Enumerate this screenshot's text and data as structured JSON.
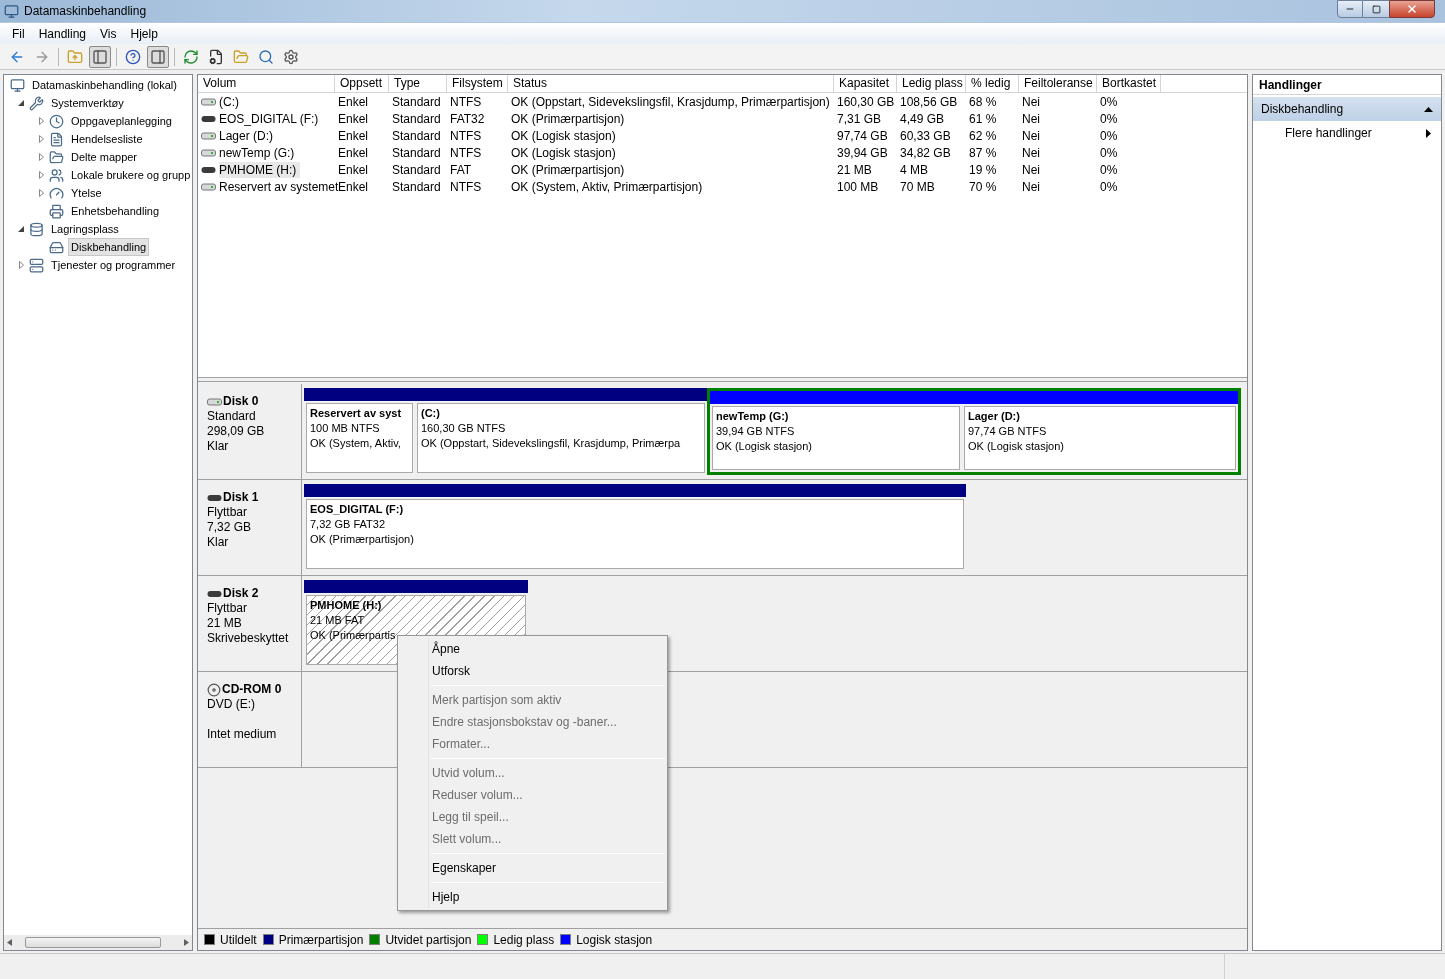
{
  "window": {
    "title": "Datamaskinbehandling"
  },
  "menu": [
    "Fil",
    "Handling",
    "Vis",
    "Hjelp"
  ],
  "toolbar": [
    {
      "pressed": false,
      "disabled": false
    },
    {
      "pressed": false,
      "disabled": true
    },
    {
      "pressed": false,
      "disabled": false
    },
    {
      "pressed": true,
      "disabled": false
    },
    {
      "pressed": false,
      "disabled": false
    },
    {
      "pressed": true,
      "disabled": false
    },
    {
      "pressed": false,
      "disabled": false
    },
    {
      "pressed": false,
      "disabled": false
    },
    {
      "pressed": false,
      "disabled": false
    },
    {
      "pressed": false,
      "disabled": false
    },
    {
      "pressed": false,
      "disabled": false
    }
  ],
  "tree": [
    {
      "label": "Datamaskinbehandling (lokal)",
      "selected": false,
      "children": [
        {
          "label": "Systemverktøy",
          "selected": false,
          "expanded": true,
          "children": [
            {
              "label": "Oppgaveplanlegging",
              "selected": false,
              "expanded": false
            },
            {
              "label": "Hendelsesliste",
              "selected": false,
              "expanded": false
            },
            {
              "label": "Delte mapper",
              "selected": false,
              "expanded": false
            },
            {
              "label": "Lokale brukere og grupp",
              "selected": false,
              "expanded": false
            },
            {
              "label": "Ytelse",
              "selected": false,
              "expanded": false
            },
            {
              "label": "Enhetsbehandling",
              "selected": false
            }
          ]
        },
        {
          "label": "Lagringsplass",
          "selected": false,
          "expanded": true,
          "children": [
            {
              "label": "Diskbehandling",
              "selected": true
            }
          ]
        },
        {
          "label": "Tjenester og programmer",
          "selected": false,
          "expanded": false
        }
      ]
    }
  ],
  "volumes": {
    "columns": [
      "Volum",
      "Oppsett",
      "Type",
      "Filsystem",
      "Status",
      "Kapasitet",
      "Ledig plass",
      "% ledig",
      "Feiltoleranse",
      "Bortkastet"
    ],
    "rows": [
      {
        "kind": "fixed",
        "selected": false,
        "cells": [
          "(C:)",
          "Enkel",
          "Standard",
          "NTFS",
          "OK (Oppstart, Sidevekslingsfil, Krasjdump, Primærpartisjon)",
          "160,30 GB",
          "108,56 GB",
          "68 %",
          "Nei",
          "0%"
        ]
      },
      {
        "kind": "removable",
        "selected": false,
        "cells": [
          "EOS_DIGITAL (F:)",
          "Enkel",
          "Standard",
          "FAT32",
          "OK (Primærpartisjon)",
          "7,31 GB",
          "4,49 GB",
          "61 %",
          "Nei",
          "0%"
        ]
      },
      {
        "kind": "fixed",
        "selected": false,
        "cells": [
          "Lager (D:)",
          "Enkel",
          "Standard",
          "NTFS",
          "OK (Logisk stasjon)",
          "97,74 GB",
          "60,33 GB",
          "62 %",
          "Nei",
          "0%"
        ]
      },
      {
        "kind": "fixed",
        "selected": false,
        "cells": [
          "newTemp (G:)",
          "Enkel",
          "Standard",
          "NTFS",
          "OK (Logisk stasjon)",
          "39,94 GB",
          "34,82 GB",
          "87 %",
          "Nei",
          "0%"
        ]
      },
      {
        "kind": "removable",
        "selected": true,
        "cells": [
          "PMHOME (H:)",
          "Enkel",
          "Standard",
          "FAT",
          "OK (Primærpartisjon)",
          "21 MB",
          "4 MB",
          "19 %",
          "Nei",
          "0%"
        ]
      },
      {
        "kind": "fixed",
        "selected": false,
        "cells": [
          "Reservert av systemet",
          "Enkel",
          "Standard",
          "NTFS",
          "OK (System, Aktiv, Primærpartisjon)",
          "100 MB",
          "70 MB",
          "70 %",
          "Nei",
          "0%"
        ]
      }
    ]
  },
  "disks": [
    {
      "kind": "fixed",
      "name": "Disk 0",
      "lines": [
        "Standard",
        "298,09 GB",
        "Klar"
      ],
      "partitions": [
        {
          "kind": "primary",
          "selected": false,
          "name": "Reservert av syst",
          "lines": [
            "100 MB NTFS",
            "OK (System, Aktiv,"
          ]
        },
        {
          "kind": "primary",
          "selected": false,
          "name": "(C:)",
          "lines": [
            "160,30 GB NTFS",
            "OK (Oppstart, Sidevekslingsfil, Krasjdump, Primærpa"
          ]
        },
        {
          "kind": "extended",
          "children": [
            {
              "kind": "logical",
              "selected": false,
              "name": "newTemp (G:)",
              "lines": [
                "39,94 GB NTFS",
                "OK (Logisk stasjon)"
              ]
            },
            {
              "kind": "logical",
              "selected": false,
              "name": "Lager (D:)",
              "lines": [
                "97,74 GB NTFS",
                "OK (Logisk stasjon)"
              ]
            }
          ]
        }
      ]
    },
    {
      "kind": "removable",
      "name": "Disk 1",
      "lines": [
        "Flyttbar",
        "7,32 GB",
        "Klar"
      ],
      "partitions": [
        {
          "kind": "primary",
          "selected": false,
          "name": "EOS_DIGITAL (F:)",
          "lines": [
            "7,32 GB FAT32",
            "OK (Primærpartisjon)"
          ]
        }
      ]
    },
    {
      "kind": "removable",
      "name": "Disk 2",
      "lines": [
        "Flyttbar",
        "21 MB",
        "Skrivebeskyttet"
      ],
      "partitions": [
        {
          "kind": "primary",
          "selected": true,
          "name": "PMHOME (H:)",
          "lines": [
            "21 MB FAT",
            "OK (Primærpartis"
          ]
        }
      ]
    },
    {
      "kind": "cdrom",
      "name": "CD-ROM 0",
      "lines": [
        "DVD (E:)",
        "Intet medium"
      ]
    }
  ],
  "legend": [
    {
      "label": "Utildelt",
      "color": "#000000"
    },
    {
      "label": "Primærpartisjon",
      "color": "#000080"
    },
    {
      "label": "Utvidet partisjon",
      "color": "#008000"
    },
    {
      "label": "Ledig plass",
      "color": "#00ff00"
    },
    {
      "label": "Logisk stasjon",
      "color": "#0000ff"
    }
  ],
  "actions": {
    "title": "Handlinger",
    "sections": [
      {
        "label": "Diskbehandling",
        "expanded": true,
        "items": [
          {
            "label": "Flere handlinger"
          }
        ]
      }
    ]
  },
  "context_menu": {
    "groups": [
      {
        "items": [
          {
            "label": "Åpne",
            "disabled": false
          },
          {
            "label": "Utforsk",
            "disabled": false
          }
        ]
      },
      {
        "items": [
          {
            "label": "Merk partisjon som aktiv",
            "disabled": true
          },
          {
            "label": "Endre stasjonsbokstav og -baner...",
            "disabled": true
          },
          {
            "label": "Formater...",
            "disabled": true
          }
        ]
      },
      {
        "items": [
          {
            "label": "Utvid volum...",
            "disabled": true
          },
          {
            "label": "Reduser volum...",
            "disabled": true
          },
          {
            "label": "Legg til speil...",
            "disabled": true
          },
          {
            "label": "Slett volum...",
            "disabled": true
          }
        ]
      },
      {
        "items": [
          {
            "label": "Egenskaper",
            "disabled": false
          }
        ]
      },
      {
        "items": [
          {
            "label": "Hjelp",
            "disabled": false
          }
        ]
      }
    ]
  }
}
